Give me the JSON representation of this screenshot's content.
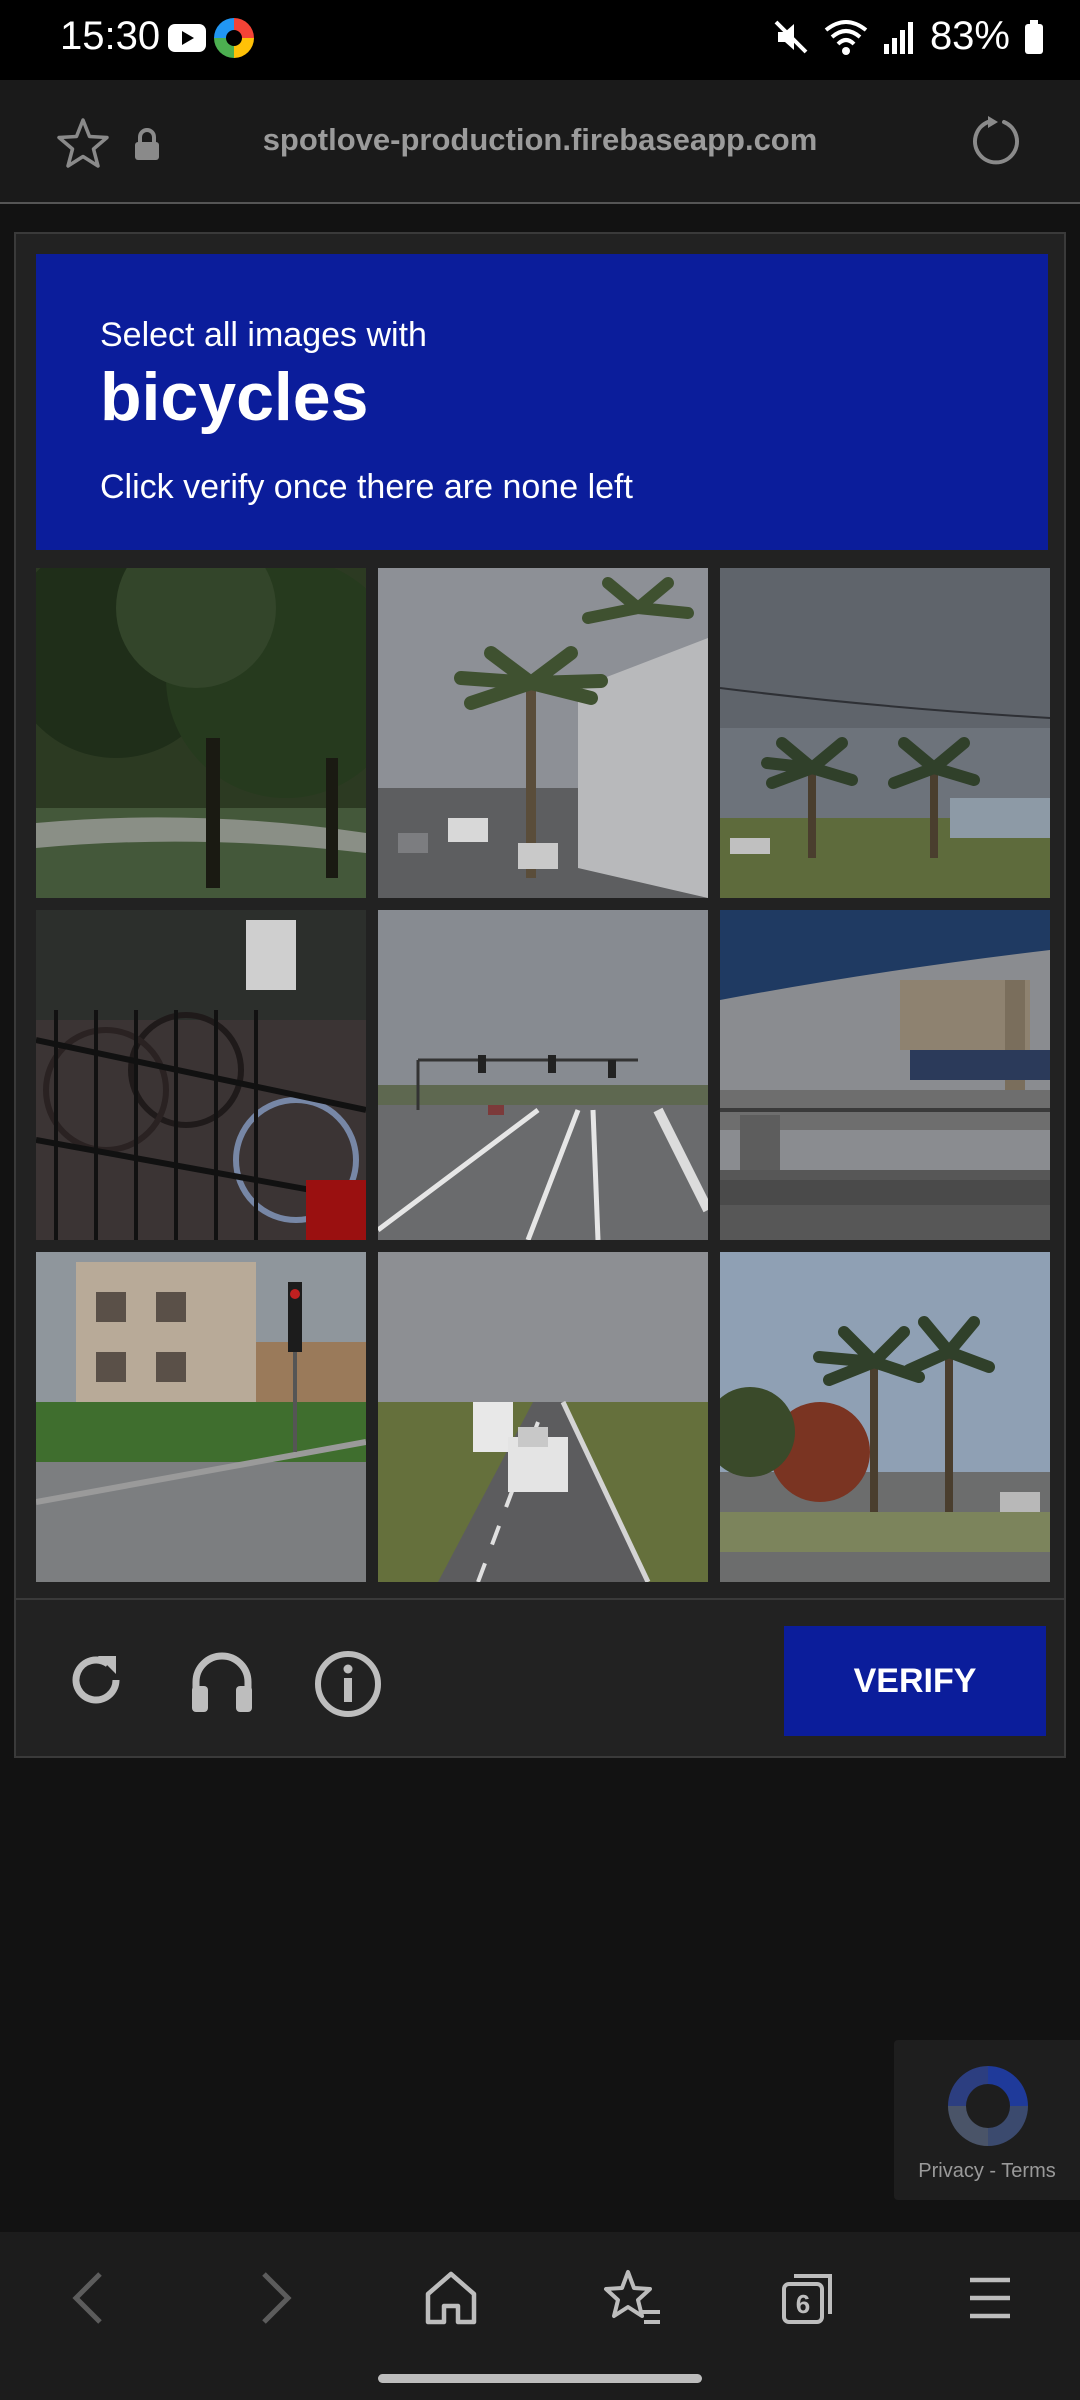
{
  "status_bar": {
    "time": "15:30",
    "battery": "83%"
  },
  "browser": {
    "url": "spotlove-production.firebaseapp.com"
  },
  "captcha": {
    "prompt": "Select all images with",
    "target": "bicycles",
    "instruction": "Click verify once there are none left",
    "verify_label": "VERIFY",
    "accent_color": "#0b1d9b"
  },
  "recaptcha_badge": {
    "privacy": "Privacy",
    "separator": "-",
    "terms": "Terms"
  },
  "tabs": {
    "count": "6"
  }
}
